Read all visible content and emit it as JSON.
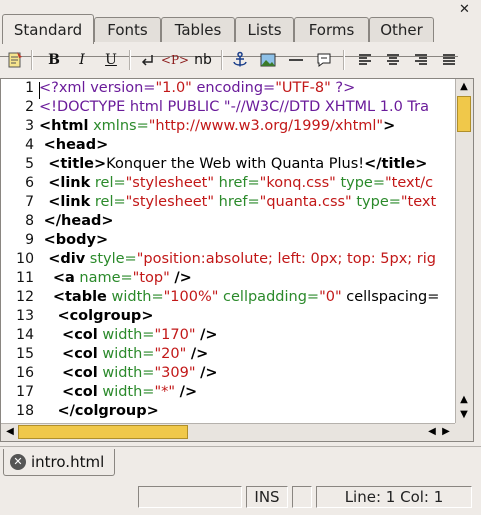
{
  "toolbar_tabs": [
    "Standard",
    "Fonts",
    "Tables",
    "Lists",
    "Forms",
    "Other"
  ],
  "active_tab": "Standard",
  "close_glyph": "✕",
  "toolbar": {
    "quick_start_icon": "quick-start-icon",
    "bold": "B",
    "italic": "I",
    "underline": "U",
    "br_icon": "line-break-icon",
    "p_label": "<P>",
    "nbsp_label": "nb",
    "anchor_icon": "anchor-icon",
    "image_icon": "image-icon",
    "hr_icon": "horizontal-rule-icon",
    "comment_icon": "comment-icon",
    "align_left_icon": "align-left-icon",
    "align_center_icon": "align-center-icon",
    "align_right_icon": "align-right-icon",
    "align_justify_icon": "align-justify-icon"
  },
  "editor": {
    "line_numbers": [
      "1",
      "2",
      "3",
      "4",
      "5",
      "6",
      "7",
      "8",
      "9",
      "10",
      "11",
      "12",
      "13",
      "14",
      "15",
      "16",
      "17",
      "18"
    ],
    "lines": [
      "<?xml version=\"1.0\" encoding=\"UTF-8\" ?>",
      "<!DOCTYPE html PUBLIC \"-//W3C//DTD XHTML 1.0 Tra",
      "<html xmlns=\"http://www.w3.org/1999/xhtml\">",
      " <head>",
      "  <title>Konquer the Web with Quanta Plus!</title>",
      "  <link rel=\"stylesheet\" href=\"konq.css\" type=\"text/c",
      "  <link rel=\"stylesheet\" href=\"quanta.css\" type=\"text",
      " </head>",
      " <body>",
      "  <div style=\"position:absolute; left: 0px; top: 5px; rig",
      "   <a name=\"top\" />",
      "   <table width=\"100%\" cellpadding=\"0\" cellspacing=",
      "    <colgroup>",
      "     <col width=\"170\" />",
      "     <col width=\"20\" />",
      "     <col width=\"309\" />",
      "     <col width=\"*\" />",
      "    </colgroup>"
    ]
  },
  "scroll": {
    "up": "▲",
    "down": "▼",
    "left": "◀",
    "right": "▶"
  },
  "document_tab": {
    "name": "intro.html",
    "icon": "close-doc-icon"
  },
  "status": {
    "mode": "INS",
    "position": "Line: 1 Col: 1"
  }
}
